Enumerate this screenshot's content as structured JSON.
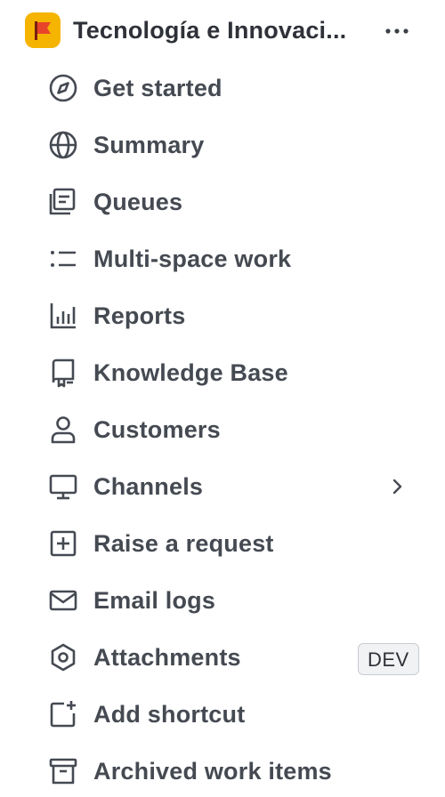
{
  "space": {
    "name": "Tecnología e Innovaci...",
    "avatar_color": "#f5b400",
    "avatar_icon": "flag-icon",
    "more_icon": "more-horizontal-icon"
  },
  "nav": {
    "items": [
      {
        "label": "Get started",
        "icon": "compass-icon"
      },
      {
        "label": "Summary",
        "icon": "globe-icon"
      },
      {
        "label": "Queues",
        "icon": "queues-icon"
      },
      {
        "label": "Multi-space work",
        "icon": "list-icon"
      },
      {
        "label": "Reports",
        "icon": "bar-chart-icon"
      },
      {
        "label": "Knowledge Base",
        "icon": "book-icon"
      },
      {
        "label": "Customers",
        "icon": "person-icon"
      },
      {
        "label": "Channels",
        "icon": "monitor-icon",
        "has_submenu": true
      },
      {
        "label": "Raise a request",
        "icon": "plus-square-icon"
      },
      {
        "label": "Email logs",
        "icon": "envelope-icon"
      },
      {
        "label": "Attachments",
        "icon": "hexagon-icon",
        "badge": "DEV"
      },
      {
        "label": "Add shortcut",
        "icon": "add-shortcut-icon"
      },
      {
        "label": "Archived work items",
        "icon": "archive-icon"
      }
    ]
  },
  "colors": {
    "text": "#454a52",
    "icon": "#454a52",
    "badge_bg": "#f1f2f4",
    "flag_red": "#e0452b"
  }
}
